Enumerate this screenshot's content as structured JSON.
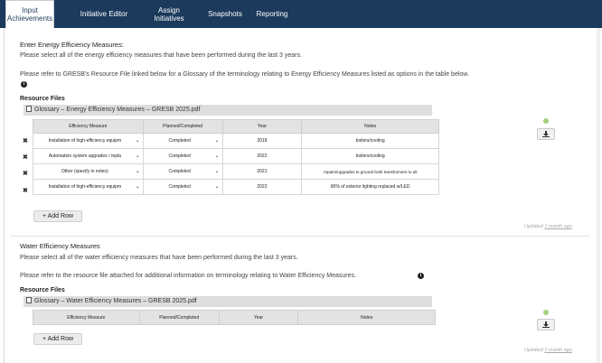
{
  "nav": {
    "tabs": [
      {
        "line1": "Input",
        "line2": "Achievements",
        "active": true
      },
      {
        "line1": "Initiative Editor",
        "line2": ""
      },
      {
        "line1": "Assign",
        "line2": "Initiatives"
      },
      {
        "line1": "Snapshots",
        "line2": ""
      },
      {
        "line1": "Reporting",
        "line2": ""
      }
    ]
  },
  "energy": {
    "heading": "Enter Energy Efficiency Measures:",
    "instruction": "Please select all of the energy efficiency measures that have been performed during the last 3 years.",
    "refer": "Please refer to GRESB's Resource File linked below for a Glossary of the terminology relating to Energy Efficiency Measures listed as options in the table below.",
    "resource_label": "Resource Files",
    "file": "Glossary – Energy Efficiency Measures – GRESB 2025.pdf",
    "columns": [
      "Efficiency Measure",
      "Planned/Completed",
      "Year",
      "Notes"
    ],
    "rows": [
      {
        "measure": "Installation of high-efficiency equipm",
        "status": "Completed",
        "year": "2018",
        "notes": "boilers/cooling"
      },
      {
        "measure": "Automation system upgrades / repla",
        "status": "Completed",
        "year": "2022",
        "notes": "boilers/cooling"
      },
      {
        "measure": "Other (specify in notes)",
        "status": "Completed",
        "year": "2021",
        "notes": "repairs/upgrades to ground both transformers to all"
      },
      {
        "measure": "Installation of high-efficiency equipm",
        "status": "Completed",
        "year": "2022",
        "notes": "80% of exterior lighting replaced w/LED"
      }
    ],
    "add_row": "+ Add Row",
    "updated_prefix": "Updated",
    "updated_link": "1 month ago"
  },
  "water": {
    "heading": "Water Efficiency Measures",
    "instruction": "Please select all of the water efficiency measures that have been performed during the last 3 years.",
    "refer": "Please refer to the resource file attached for additional information on terminology relating to Water Efficiency Measures.",
    "resource_label": "Resource Files",
    "file": "Glossary – Water Efficiency Measures – GRESB 2025.pdf",
    "columns": [
      "Efficiency Measure",
      "Planned/Completed",
      "Year",
      "Notes"
    ],
    "add_row": "+ Add Row",
    "updated_prefix": "Updated",
    "updated_link": "1 month ago"
  },
  "colors": {
    "nav": "#1b3a5c",
    "status_dot": "#a5cf7c"
  },
  "icons": [
    "info-icon",
    "pdf-file-icon",
    "delete-x-icon",
    "download-icon",
    "status-dot-icon",
    "chevron-down-icon"
  ]
}
